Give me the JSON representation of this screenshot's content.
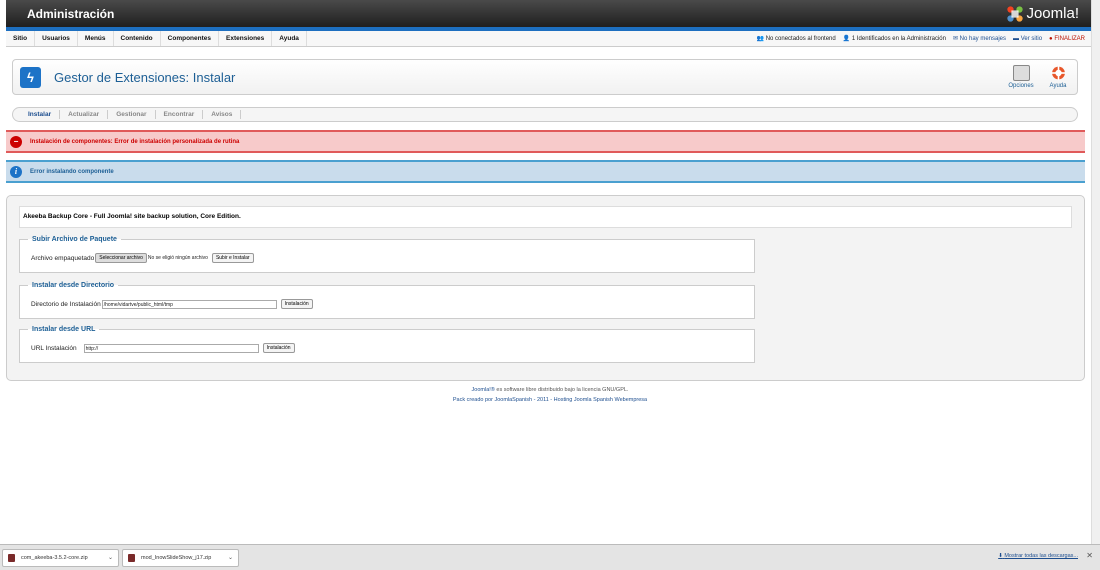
{
  "header": {
    "title": "Administración",
    "logo_text": "Joomla!"
  },
  "menu": [
    "Sitio",
    "Usuarios",
    "Menús",
    "Contenido",
    "Componentes",
    "Extensiones",
    "Ayuda"
  ],
  "status": {
    "frontend": "No conectados al frontend",
    "admin": "1 Identificados en la Administración",
    "messages": "No hay mensajes",
    "view_site": "Ver sitio",
    "logout": "FINALIZAR"
  },
  "page": {
    "title": "Gestor de Extensiones: Instalar",
    "options": "Opciones",
    "help": "Ayuda"
  },
  "tabs": [
    "Instalar",
    "Actualizar",
    "Gestionar",
    "Encontrar",
    "Avisos"
  ],
  "messages": {
    "error": "Instalación de componentes: Error de instalación personalizada de rutina",
    "info": "Error instalando componente"
  },
  "akeeba": "Akeeba Backup Core - Full Joomla! site backup solution, Core Edition.",
  "upload": {
    "legend": "Subir Archivo de Paquete",
    "label": "Archivo empaquetado",
    "choose": "Seleccionar archivo",
    "no_file": "No se eligió ningún archivo",
    "submit": "Subir e Instalar"
  },
  "directory": {
    "legend": "Instalar desde Directorio",
    "label": "Directorio de Instalación",
    "value": "/home/vidartve/public_html/tmp",
    "submit": "Instalación"
  },
  "url": {
    "legend": "Instalar desde URL",
    "label": "URL Instalación",
    "value": "http://",
    "submit": "Instalación"
  },
  "footer": {
    "line1_link": "Joomla!®",
    "line1": " es software libre distribuido bajo la licencia GNU/GPL.",
    "line2": "Pack creado por JoomlaSpanish - 2011 - Hosting Joomla Spanish Webempresa"
  },
  "downloads": [
    {
      "name": "com_akeeba-3.5.2-core.zip"
    },
    {
      "name": "mod_InowSlideShow_j17.zip"
    }
  ],
  "downloads_show_all": "Mostrar todas las descargas...",
  "colors": {
    "accent": "#1d73c7",
    "error": "#c00",
    "info": "#1d5f95"
  }
}
